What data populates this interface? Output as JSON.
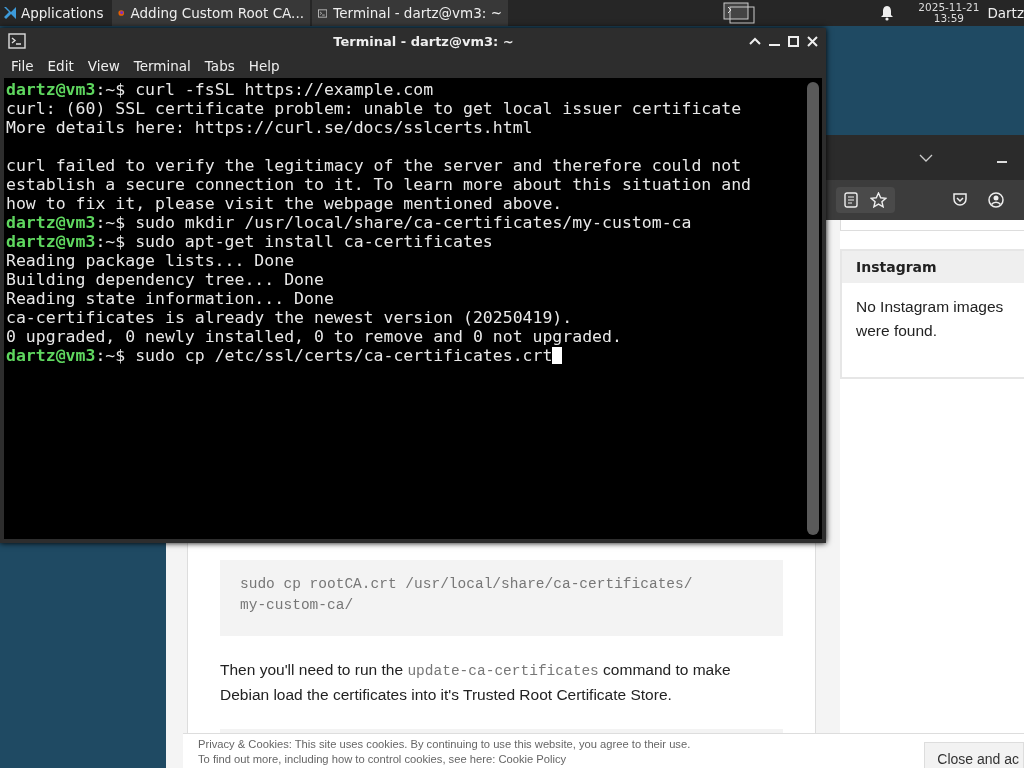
{
  "taskbar": {
    "menu_label": "Applications",
    "tasks": [
      {
        "kind": "browser",
        "label": "Adding Custom Root CA..."
      },
      {
        "kind": "terminal",
        "label": "Terminal - dartz@vm3: ~"
      }
    ],
    "clock": {
      "date": "2025-11-21",
      "time": "13:59"
    },
    "user": "Dartz"
  },
  "terminal": {
    "title": "Terminal - dartz@vm3: ~",
    "menu": [
      "File",
      "Edit",
      "View",
      "Terminal",
      "Tabs",
      "Help"
    ],
    "cursor_visible": true,
    "lines": [
      {
        "kind": "prompt",
        "prompt": "dartz@vm3",
        "separator": ":~$",
        "command": "curl -fsSL https://example.com"
      },
      {
        "kind": "output",
        "text": "curl: (60) SSL certificate problem: unable to get local issuer certificate"
      },
      {
        "kind": "output",
        "text": "More details here: https://curl.se/docs/sslcerts.html"
      },
      {
        "kind": "blank"
      },
      {
        "kind": "output",
        "text": "curl failed to verify the legitimacy of the server and therefore could not"
      },
      {
        "kind": "output",
        "text": "establish a secure connection to it. To learn more about this situation and"
      },
      {
        "kind": "output",
        "text": "how to fix it, please visit the webpage mentioned above."
      },
      {
        "kind": "prompt",
        "prompt": "dartz@vm3",
        "separator": ":~$",
        "command": "sudo mkdir /usr/local/share/ca-certificates/my-custom-ca"
      },
      {
        "kind": "prompt",
        "prompt": "dartz@vm3",
        "separator": ":~$",
        "command": "sudo apt-get install ca-certificates"
      },
      {
        "kind": "output",
        "text": "Reading package lists... Done"
      },
      {
        "kind": "output",
        "text": "Building dependency tree... Done"
      },
      {
        "kind": "output",
        "text": "Reading state information... Done"
      },
      {
        "kind": "output",
        "text": "ca-certificates is already the newest version (20250419)."
      },
      {
        "kind": "output",
        "text": "0 upgraded, 0 newly installed, 0 to remove and 0 not upgraded."
      },
      {
        "kind": "prompt",
        "prompt": "dartz@vm3",
        "separator": ":~$",
        "command": "sudo cp /etc/ssl/certs/ca-certificates.crt"
      }
    ]
  },
  "browser": {
    "article": [
      {
        "kind": "code",
        "text": "sudo cp rootCA.crt /usr/local/share/ca-certificates/\nmy-custom-ca/"
      },
      {
        "kind": "paragraph",
        "parts": [
          {
            "kind": "text",
            "text": "Then you'll need to run the "
          },
          {
            "kind": "code",
            "text": "update-ca-certificates"
          },
          {
            "kind": "text",
            "text": " command to make Debian load the certificates into it's Trusted Root Certificate Store."
          }
        ]
      },
      {
        "kind": "code_empty"
      }
    ],
    "widget": {
      "title": "Instagram",
      "body": "No Instagram images were found."
    },
    "cookie_bar": {
      "text": "Privacy & Cookies: This site uses cookies. By continuing to use this website, you agree to their use.",
      "more": "To find out more, including how to control cookies, see here:",
      "link": "Cookie Policy",
      "button": "Close and ac"
    }
  }
}
